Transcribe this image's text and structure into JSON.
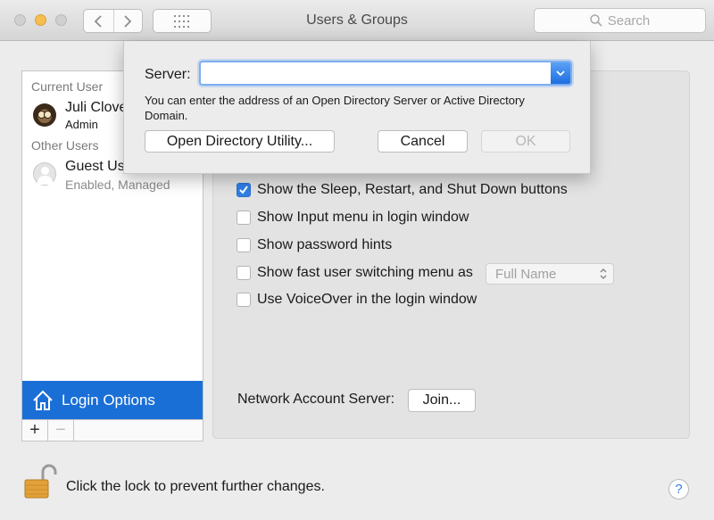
{
  "window": {
    "title": "Users & Groups",
    "search_placeholder": "Search"
  },
  "sidebar": {
    "current_user_heading": "Current User",
    "current_user": {
      "name": "Juli Clove",
      "role": "Admin",
      "avatar": "owl-avatar"
    },
    "other_users_heading": "Other Users",
    "guest_user": {
      "name": "Guest Us",
      "status": "Enabled, Managed",
      "avatar": "guest-avatar"
    },
    "login_options_label": "Login Options",
    "add_symbol": "+",
    "remove_symbol": "−"
  },
  "options": [
    {
      "label": "Show the Sleep, Restart, and Shut Down buttons",
      "checked": true
    },
    {
      "label": "Show Input menu in login window",
      "checked": false
    },
    {
      "label": "Show password hints",
      "checked": false
    },
    {
      "label": "Show fast user switching menu as",
      "checked": false
    },
    {
      "label": "Use VoiceOver in the login window",
      "checked": false
    }
  ],
  "fast_switch_popup": {
    "value": "Full Name"
  },
  "network": {
    "label": "Network Account Server:",
    "join_label": "Join..."
  },
  "bottom": {
    "lock_text": "Click the lock to prevent further changes.",
    "help_symbol": "?"
  },
  "sheet": {
    "server_label": "Server:",
    "server_value": "",
    "help_text": "You can enter the address of an Open Directory Server or Active Directory Domain.",
    "odu_label": "Open Directory Utility...",
    "cancel_label": "Cancel",
    "ok_label": "OK"
  },
  "colors": {
    "accent": "#1a6fd7",
    "checkbox": "#2f7fe6",
    "lock": "#e3a13a"
  }
}
